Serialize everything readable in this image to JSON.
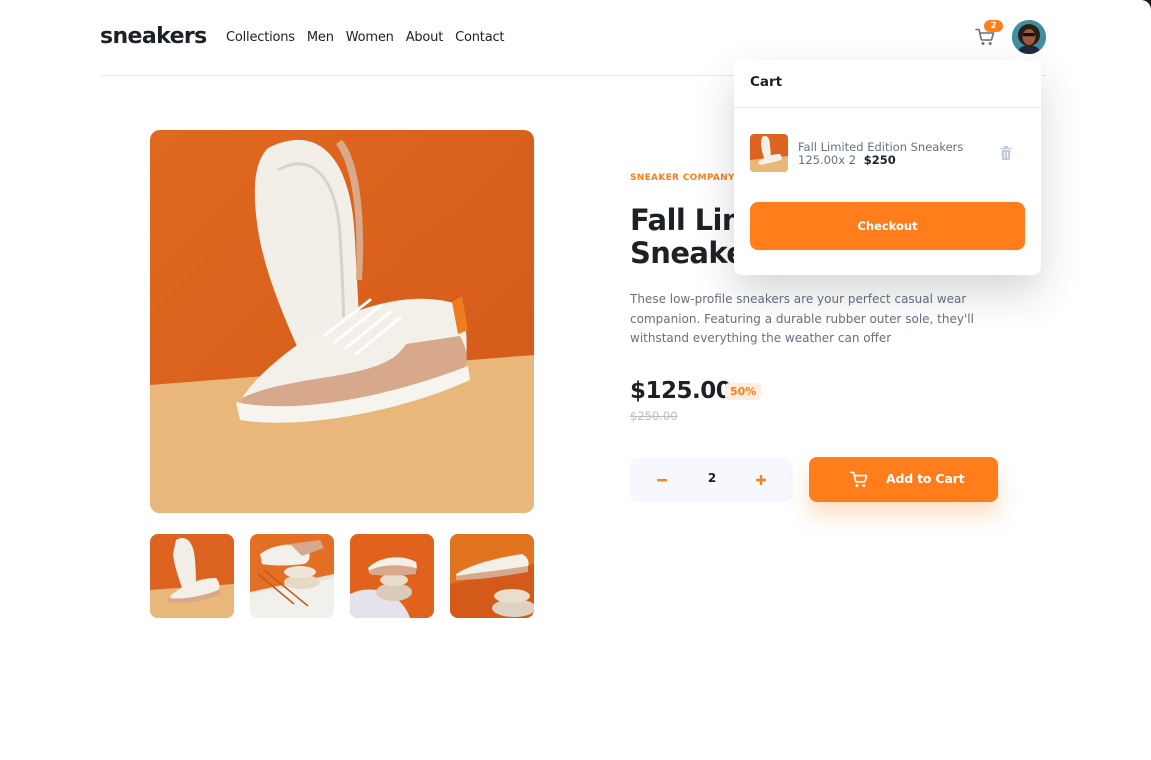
{
  "header": {
    "logo": "sneakers",
    "nav": [
      "Collections",
      "Men",
      "Women",
      "About",
      "Contact"
    ],
    "cart_count": "2",
    "cart_icon": "cart-icon",
    "avatar_icon": "avatar"
  },
  "product": {
    "company": "SNEAKER COMPANY",
    "title": "Fall Limited Edition Sneakers",
    "description": "These low-profile sneakers are your perfect casual wear companion. Featuring a durable rubber outer sole, they'll withstand everything the weather can offer",
    "price": "$125.00",
    "discount": "50%",
    "old_price": "$250.00",
    "quantity": "2",
    "add_to_cart": "Add to Cart",
    "thumbnails": [
      "thumbnail-1",
      "thumbnail-2",
      "thumbnail-3",
      "thumbnail-4"
    ]
  },
  "cart": {
    "title": "Cart",
    "item_name": "Fall Limited Edition Sneakers",
    "item_calc": "125.00x 2",
    "item_total": "$250",
    "checkout": "Checkout"
  },
  "colors": {
    "accent": "#ff7e1b",
    "accent_pale": "#ffede0",
    "text_dark": "#1d2025",
    "text_muted": "#68707d",
    "qty_bg": "#f6f8fd"
  }
}
